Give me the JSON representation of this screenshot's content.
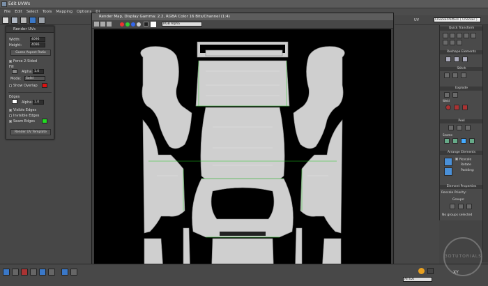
{
  "app": {
    "title": "Edit UVWs"
  },
  "menu": [
    "File",
    "Edit",
    "Select",
    "Tools",
    "Mapping",
    "Options",
    "Di"
  ],
  "toolbar": {
    "uv_label": "UV",
    "checker_select": "CheckerPattern ( Checker )"
  },
  "render_panel": {
    "title": "Render UVs",
    "width_label": "Width:",
    "width_value": "4096",
    "height_label": "Height:",
    "height_value": "4096",
    "aspect_button": "Guess Aspect Ratio",
    "force2sided": "Force 2-Sided",
    "fill_label": "Fill",
    "alpha_label": "Alpha:",
    "fill_alpha": "1.0",
    "mode_label": "Mode:",
    "mode_value": "Solid",
    "show_overlap": "Show Overlap",
    "edges_label": "Edges",
    "edge_alpha": "1.0",
    "visible_edges": "Visible Edges",
    "invisible_edges": "Invisible Edges",
    "seam_edges": "Seam Edges",
    "render_button": "Render UV Template",
    "colors": {
      "fill": "#888888",
      "overlap": "#dd1111",
      "edge": "#ffffff",
      "seam": "#22dd22"
    }
  },
  "render_window": {
    "title": "Render Map, Display Gamma: 2.2, RGBA Color 16 Bits/Channel (1:4)",
    "channel_select": "RGB Alpha"
  },
  "right_panel": {
    "quick_transform": "Quick Transform",
    "reshape": "Reshape Elements",
    "stitch": "Stitch",
    "explode": "Explode",
    "weld": "Weld",
    "peel": "Peel",
    "seams": "Seams:",
    "arrange": "Arrange Elements",
    "rescale": "Rescale",
    "rotate": "Rotate",
    "padding": "Padding:",
    "element_props": "Element Properties",
    "rescale_priority": "Rescale Priority:",
    "groups": "Groups:",
    "no_groups": "No groups selected"
  },
  "bottom": {
    "allids": "All IDs",
    "xy": "XY",
    "watermark": "3DTUTORIALS"
  }
}
